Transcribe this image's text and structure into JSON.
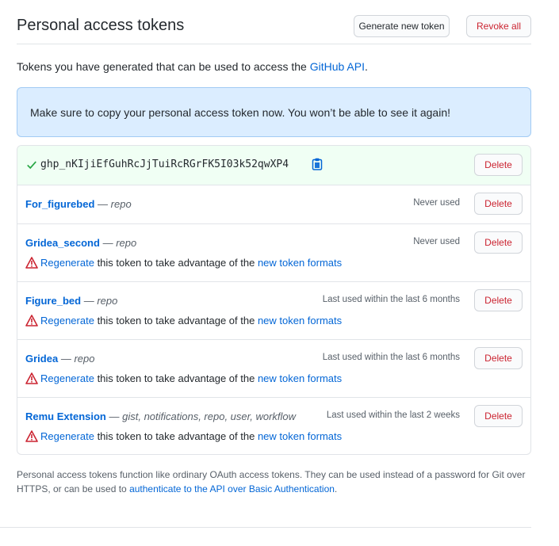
{
  "header": {
    "title": "Personal access tokens",
    "generate_label": "Generate new token",
    "revoke_label": "Revoke all"
  },
  "intro": {
    "text": "Tokens you have generated that can be used to access the ",
    "link": "GitHub API",
    "suffix": "."
  },
  "flash": {
    "message": "Make sure to copy your personal access token now. You won’t be able to see it again!"
  },
  "new_token": {
    "value": "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",
    "delete_label": "Delete"
  },
  "tokens": [
    {
      "name": "For_figurebed",
      "scopes": "repo",
      "usage": "Never used",
      "delete_label": "Delete"
    },
    {
      "name": "Gridea_second",
      "scopes": "repo",
      "usage": "Never used",
      "delete_label": "Delete",
      "regen_link": "Regenerate",
      "regen_text": " this token to take advantage of the ",
      "regen_link2": "new token formats"
    },
    {
      "name": "Figure_bed",
      "scopes": "repo",
      "usage": "Last used within the last 6 months",
      "delete_label": "Delete",
      "regen_link": "Regenerate",
      "regen_text": " this token to take advantage of the ",
      "regen_link2": "new token formats"
    },
    {
      "name": "Gridea",
      "scopes": "repo",
      "usage": "Last used within the last 6 months",
      "delete_label": "Delete",
      "regen_link": "Regenerate",
      "regen_text": " this token to take advantage of the ",
      "regen_link2": "new token formats"
    },
    {
      "name": "Remu Extension",
      "scopes": "gist, notifications, repo, user, workflow",
      "usage": "Last used within the last 2 weeks",
      "delete_label": "Delete",
      "regen_link": "Regenerate",
      "regen_text": " this token to take advantage of the ",
      "regen_link2": "new token formats"
    }
  ],
  "footer": {
    "text": "Personal access tokens function like ordinary OAuth access tokens. They can be used instead of a password for Git over HTTPS, or can be used to ",
    "link": "authenticate to the API over Basic Authentication",
    "suffix": "."
  },
  "icons": {
    "check": "check-icon",
    "copy": "clipboard-icon",
    "alert": "alert-triangle-icon"
  },
  "colors": {
    "link": "#0366d6",
    "danger": "#cb2431",
    "success_bg": "#f0fff4",
    "flash_bg": "#dbedff",
    "check": "#28a745"
  }
}
